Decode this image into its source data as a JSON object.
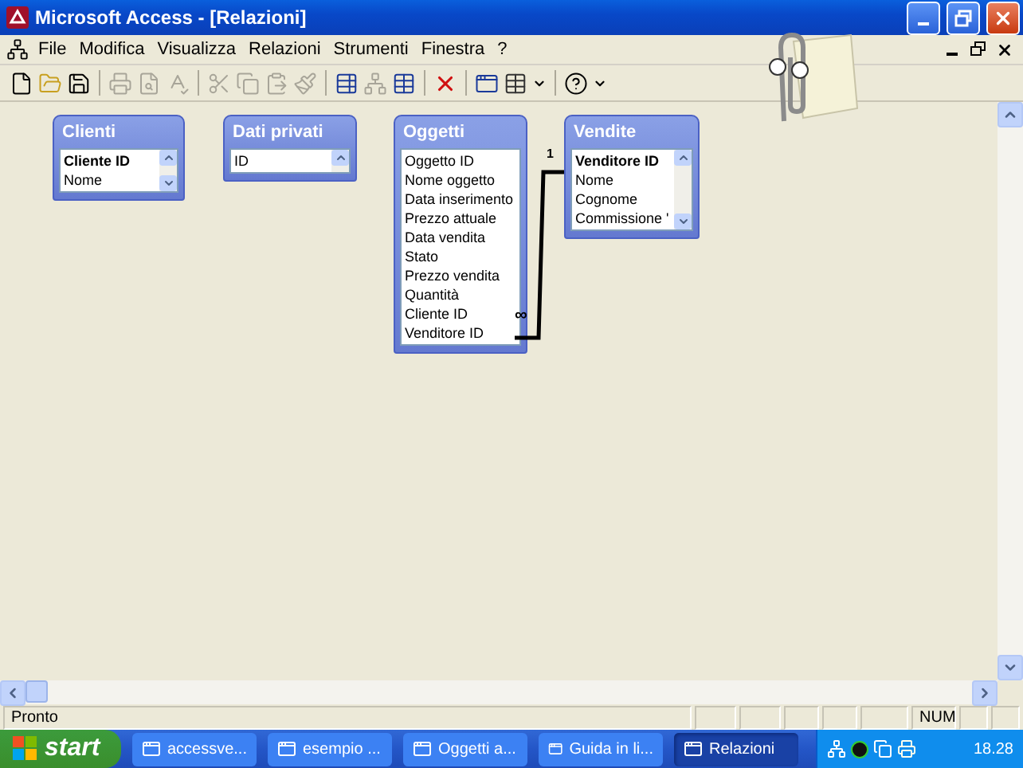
{
  "window": {
    "title": "Microsoft Access - [Relazioni]"
  },
  "menu": [
    {
      "label": "File"
    },
    {
      "label": "Modifica"
    },
    {
      "label": "Visualizza"
    },
    {
      "label": "Relazioni"
    },
    {
      "label": "Strumenti"
    },
    {
      "label": "Finestra"
    },
    {
      "label": "?"
    }
  ],
  "tables": [
    {
      "title": "Clienti",
      "scroll": true,
      "fields": [
        {
          "name": "Cliente  ID",
          "key": true
        },
        {
          "name": "Nome",
          "key": false
        }
      ]
    },
    {
      "title": "Dati privati",
      "scroll": true,
      "fields": [
        {
          "name": "ID",
          "key": false
        }
      ]
    },
    {
      "title": "Oggetti",
      "scroll": false,
      "fields": [
        {
          "name": "Oggetto ID",
          "key": false
        },
        {
          "name": "Nome oggetto",
          "key": false
        },
        {
          "name": "Data inserimento",
          "key": false
        },
        {
          "name": "Prezzo attuale",
          "key": false
        },
        {
          "name": "Data vendita",
          "key": false
        },
        {
          "name": "Stato",
          "key": false
        },
        {
          "name": "Prezzo vendita",
          "key": false
        },
        {
          "name": "Quantità",
          "key": false
        },
        {
          "name": "Cliente ID",
          "key": false
        },
        {
          "name": "Venditore ID",
          "key": false
        }
      ]
    },
    {
      "title": "Vendite",
      "scroll": true,
      "fields": [
        {
          "name": "Venditore ID",
          "key": true
        },
        {
          "name": "Nome",
          "key": false
        },
        {
          "name": "Cognome",
          "key": false
        },
        {
          "name": "Commissione '",
          "key": false
        }
      ]
    }
  ],
  "relationship": {
    "one_label": "1",
    "many_label": "∞"
  },
  "status_bar": {
    "text": "Pronto",
    "indicator": "NUM"
  },
  "taskbar": {
    "start": "start",
    "items": [
      {
        "label": "accessve...",
        "selected": false
      },
      {
        "label": "esempio ...",
        "selected": false
      },
      {
        "label": "Oggetti a...",
        "selected": false
      },
      {
        "label": "Guida in li...",
        "selected": false
      },
      {
        "label": "Relazioni",
        "selected": true
      }
    ],
    "clock": "18.28"
  }
}
